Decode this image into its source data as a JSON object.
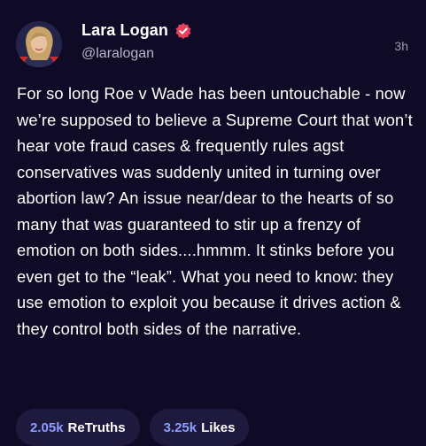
{
  "post": {
    "author": {
      "display_name": "Lara Logan",
      "handle": "@laralogan",
      "verified_icon": "verified-badge-icon",
      "avatar_icon": "avatar"
    },
    "timestamp": "3h",
    "text": "For so long Roe v Wade has been untouchable - now we’re supposed to believe a Supreme Court that won’t hear vote fraud cases & frequently rules agst conservatives was suddenly united in turning over abortion law? An issue near/dear to the hearts of so many that was guaranteed to stir up a frenzy of emotion on both sides....hmmm. It stinks before you even get to the “leak”. What you need to know: they use emotion to exploit you because it drives action & they control both sides of the narrative.",
    "stats": {
      "retruths": {
        "count": "2.05k",
        "label": "ReTruths"
      },
      "likes": {
        "count": "3.25k",
        "label": "Likes"
      }
    }
  },
  "colors": {
    "background": "#0f0a25",
    "pill_background": "#1e1a3d",
    "accent": "#8f9cff",
    "verified": "#e8405f"
  }
}
